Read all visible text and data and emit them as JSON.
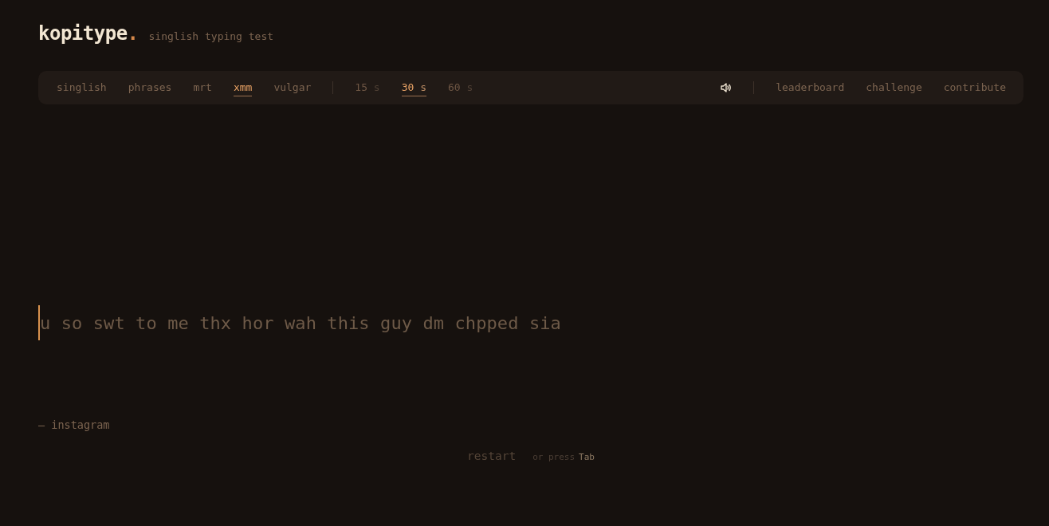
{
  "header": {
    "logo": "kopitype",
    "logo_mark": ".",
    "tagline": "singlish typing test"
  },
  "toolbar": {
    "modes": [
      {
        "label": "singlish",
        "selected": false
      },
      {
        "label": "phrases",
        "selected": false
      },
      {
        "label": "mrt",
        "selected": false
      },
      {
        "label": "xmm",
        "selected": true
      },
      {
        "label": "vulgar",
        "selected": false
      }
    ],
    "durations": [
      {
        "value": "15",
        "unit": "s",
        "selected": false
      },
      {
        "value": "30",
        "unit": "s",
        "selected": true
      },
      {
        "value": "60",
        "unit": "s",
        "selected": false
      }
    ],
    "sound": {
      "on": true
    },
    "links": [
      "leaderboard",
      "challenge",
      "contribute"
    ]
  },
  "test": {
    "words": "u so swt to me thx hor wah this guy dm chpped sia",
    "source": "— instagram"
  },
  "footer": {
    "restart": "restart",
    "hint": "or press",
    "key": "Tab"
  }
}
